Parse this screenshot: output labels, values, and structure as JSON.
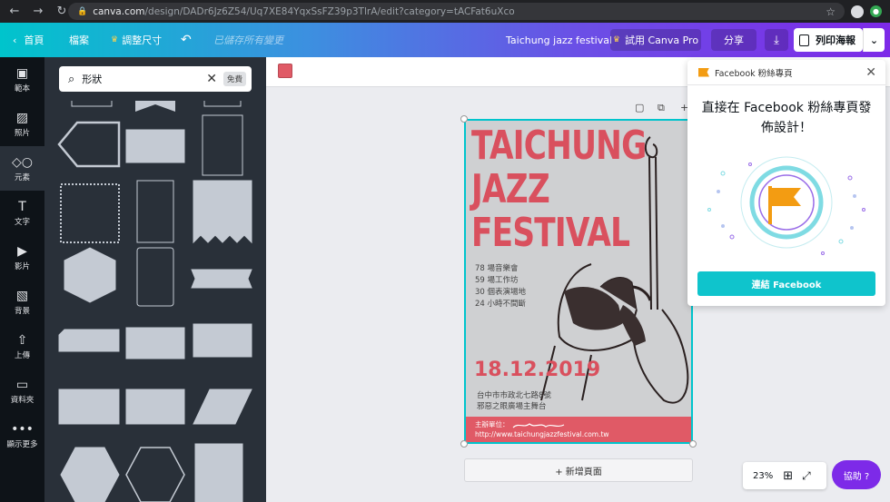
{
  "browser": {
    "url_domain": "canva.com",
    "url_path": "/design/DADr6Jz6Z54/Uq7XE84YqxSsFZ39p3TlrA/edit?category=tACFat6uXco"
  },
  "topbar": {
    "home": "首頁",
    "file": "檔案",
    "resize": "調整尺寸",
    "saved_status": "已儲存所有變更",
    "design_title": "Taichung jazz festival",
    "try_pro": "試用 Canva Pro",
    "share": "分享",
    "print": "列印海報"
  },
  "rail": {
    "items": [
      {
        "label": "範本",
        "icon": "template-icon"
      },
      {
        "label": "照片",
        "icon": "photo-icon"
      },
      {
        "label": "元素",
        "icon": "elements-icon"
      },
      {
        "label": "文字",
        "icon": "text-icon"
      },
      {
        "label": "影片",
        "icon": "video-icon"
      },
      {
        "label": "背景",
        "icon": "background-icon"
      },
      {
        "label": "上傳",
        "icon": "upload-icon"
      },
      {
        "label": "資料夾",
        "icon": "folder-icon"
      },
      {
        "label": "顯示更多",
        "icon": "more-icon"
      }
    ]
  },
  "search": {
    "value": "形狀",
    "badge": "免費"
  },
  "poster": {
    "title_lines": [
      "TAICHUNG",
      "JAZZ",
      "FESTIVAL"
    ],
    "stats": [
      "78 場音樂會",
      "59 場工作坊",
      "30 個表演場地",
      "24 小時不間斷"
    ],
    "date": "18.12.2019",
    "address": [
      "台中市市政北七路8號",
      "邪惡之眼廣場主舞台"
    ],
    "organizer_label": "主辦單位：",
    "website": "http://www.taichungjazzfestival.com.tw"
  },
  "canvas": {
    "add_page": "+ 新增頁面",
    "zoom": "23%"
  },
  "fb_popup": {
    "header": "Facebook 粉絲專頁",
    "title": "直接在 Facebook 粉絲專頁發佈設計！",
    "connect": "連結 Facebook"
  },
  "help": {
    "label": "協助 ?"
  },
  "colors": {
    "accent_teal": "#00c4cc",
    "accent_purple": "#7d2ae8",
    "poster_red": "#e05a66"
  }
}
